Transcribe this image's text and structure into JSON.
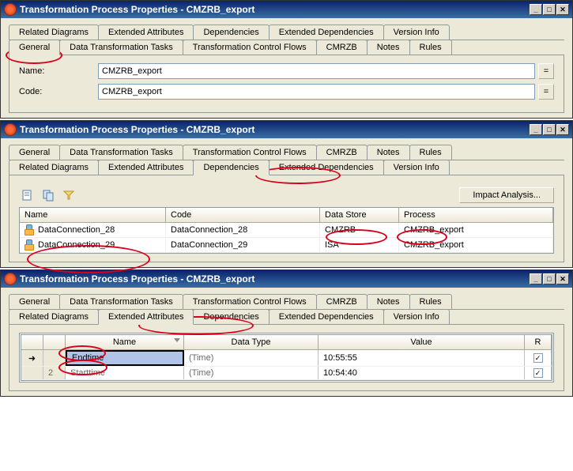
{
  "window1": {
    "title_prefix": "Transformation Process Properties - ",
    "title_name": "CMZRB_export",
    "tabs_row1": [
      "Related Diagrams",
      "Extended Attributes",
      "Dependencies",
      "Extended Dependencies",
      "Version Info"
    ],
    "tabs_row2": [
      "General",
      "Data Transformation Tasks",
      "Transformation Control Flows",
      "CMRZB",
      "Notes",
      "Rules"
    ],
    "active_tab": "General",
    "name_label": "Name:",
    "name_value": "CMZRB_export",
    "code_label": "Code:",
    "code_value": "CMZRB_export",
    "eq": "="
  },
  "window2": {
    "title_prefix": "Transformation Process Properties - ",
    "title_name": "CMZRB_export",
    "tabs_row1": [
      "General",
      "Data Transformation Tasks",
      "Transformation Control Flows",
      "CMRZB",
      "Notes",
      "Rules"
    ],
    "tabs_row2": [
      "Related Diagrams",
      "Extended Attributes",
      "Dependencies",
      "Extended Dependencies",
      "Version Info"
    ],
    "active_tab": "Dependencies",
    "impact_label": "Impact Analysis...",
    "cols": {
      "name": "Name",
      "code": "Code",
      "datastore": "Data Store",
      "process": "Process"
    },
    "rows": [
      {
        "name": "DataConnection_28",
        "code": "DataConnection_28",
        "datastore": "CMZRB",
        "process": "CMZRB_export"
      },
      {
        "name": "DataConnection_29",
        "code": "DataConnection_29",
        "datastore": "ISA",
        "process": "CMZRB_export"
      }
    ]
  },
  "window3": {
    "title_prefix": "Transformation Process Properties - ",
    "title_name": "CMZRB_export",
    "tabs_row1": [
      "General",
      "Data Transformation Tasks",
      "Transformation Control Flows",
      "CMRZB",
      "Notes",
      "Rules"
    ],
    "tabs_row2": [
      "Related Diagrams",
      "Extended Attributes",
      "Dependencies",
      "Extended Dependencies",
      "Version Info"
    ],
    "active_tab": "Extended Attributes",
    "cols": {
      "name": "Name",
      "datatype": "Data Type",
      "value": "Value",
      "r": "R"
    },
    "rows": [
      {
        "num": "",
        "sel": "arrow",
        "name": "Endtime",
        "datatype": "(Time)",
        "value": "10:55:55",
        "r": true
      },
      {
        "num": "2",
        "sel": "",
        "name": "Starttime",
        "datatype": "(Time)",
        "value": "10:54:40",
        "r": true
      }
    ]
  }
}
